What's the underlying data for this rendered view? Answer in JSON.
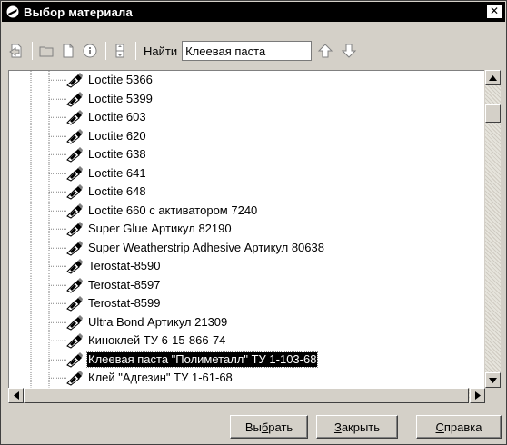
{
  "window": {
    "title": "Выбор материала",
    "close_glyph": "✕"
  },
  "toolbar": {
    "icons": [
      "document-arrow-icon",
      "folder-icon",
      "page-icon",
      "info-icon",
      "split-icon"
    ],
    "find_label": "Найти",
    "find_value": "Клеевая паста",
    "up_icon": "arrow-up-icon",
    "down_icon": "arrow-down-icon"
  },
  "tree": {
    "node_icon": "glue-tube-icon",
    "items": [
      {
        "label": "Loctite 5366",
        "selected": false
      },
      {
        "label": "Loctite 5399",
        "selected": false
      },
      {
        "label": "Loctite 603",
        "selected": false
      },
      {
        "label": "Loctite 620",
        "selected": false
      },
      {
        "label": "Loctite 638",
        "selected": false
      },
      {
        "label": "Loctite 641",
        "selected": false
      },
      {
        "label": "Loctite 648",
        "selected": false
      },
      {
        "label": "Loctite 660 с активатором 7240",
        "selected": false
      },
      {
        "label": "Super Glue Артикул 82190",
        "selected": false
      },
      {
        "label": "Super Weatherstrip Adhesive Артикул 80638",
        "selected": false
      },
      {
        "label": "Terostat-8590",
        "selected": false
      },
      {
        "label": "Terostat-8597",
        "selected": false
      },
      {
        "label": "Terostat-8599",
        "selected": false
      },
      {
        "label": "Ultra Bond Артикул 21309",
        "selected": false
      },
      {
        "label": "Киноклей ТУ 6-15-866-74",
        "selected": false
      },
      {
        "label": "Клеевая паста \"Полиметалл\" ТУ 1-103-68",
        "selected": true
      },
      {
        "label": "Клей \"Адгезин\" ТУ 1-61-68",
        "selected": false
      }
    ]
  },
  "buttons": {
    "select": {
      "pre": "Вы",
      "accel": "б",
      "post": "рать"
    },
    "close": {
      "pre": "",
      "accel": "З",
      "post": "акрыть"
    },
    "help": {
      "pre": "",
      "accel": "С",
      "post": "правка"
    }
  },
  "colors": {
    "face": "#d4d0c8",
    "titlebar": "#000000",
    "selection": "#000000"
  }
}
